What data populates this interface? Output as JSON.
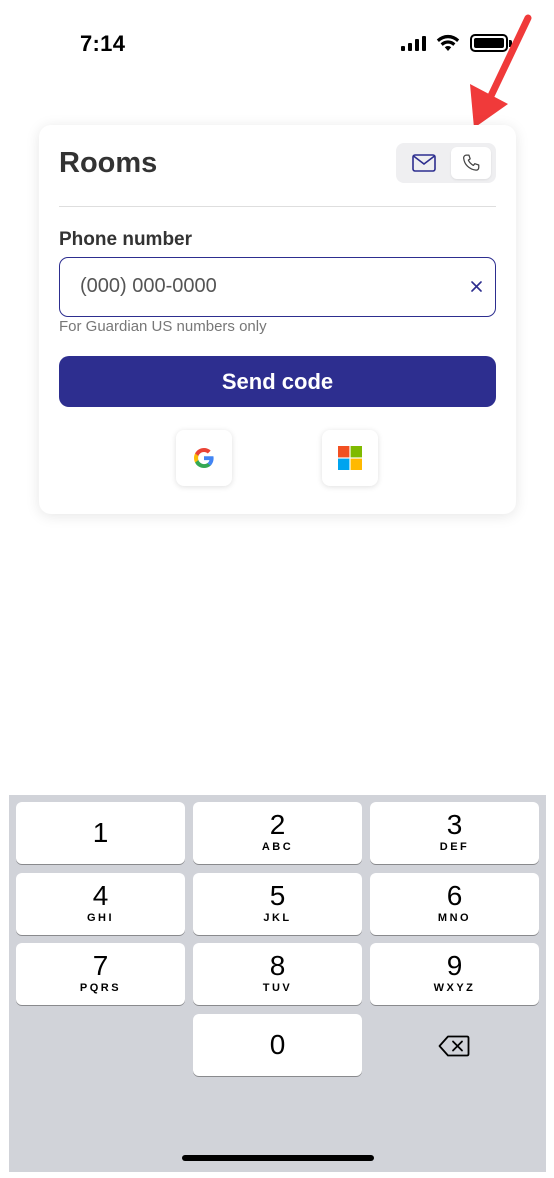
{
  "status_bar": {
    "time": "7:14",
    "icons": [
      "cellular-signal-icon",
      "wifi-icon",
      "battery-icon"
    ]
  },
  "annotation": {
    "icon": "red-arrow-icon",
    "color": "#f03a3a"
  },
  "card": {
    "title": "Rooms",
    "login_method_toggle": [
      {
        "icon": "mail-icon",
        "selected": false
      },
      {
        "icon": "phone-icon",
        "selected": true
      }
    ],
    "phone_field": {
      "label": "Phone number",
      "value": "",
      "placeholder": "(000) 000-0000",
      "clear_label": "×",
      "helper": "For Guardian US numbers only"
    },
    "send_button_label": "Send code",
    "sso": [
      {
        "icon": "google-logo-icon"
      },
      {
        "icon": "microsoft-logo-icon"
      }
    ],
    "colors": {
      "primary": "#2d2e8f",
      "title": "#333333"
    }
  },
  "keypad": {
    "keys": [
      {
        "digit": "1",
        "letters": ""
      },
      {
        "digit": "2",
        "letters": "ABC"
      },
      {
        "digit": "3",
        "letters": "DEF"
      },
      {
        "digit": "4",
        "letters": "GHI"
      },
      {
        "digit": "5",
        "letters": "JKL"
      },
      {
        "digit": "6",
        "letters": "MNO"
      },
      {
        "digit": "7",
        "letters": "PQRS"
      },
      {
        "digit": "8",
        "letters": "TUV"
      },
      {
        "digit": "9",
        "letters": "WXYZ"
      },
      {
        "digit": "0",
        "letters": ""
      }
    ],
    "delete_icon": "backspace-icon"
  }
}
